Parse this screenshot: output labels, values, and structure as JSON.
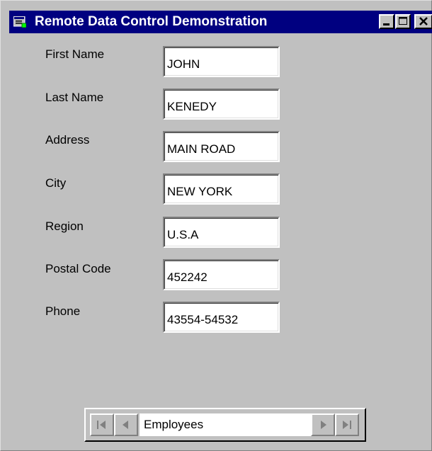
{
  "window": {
    "title": "Remote Data Control Demonstration",
    "icon": "app-form-icon"
  },
  "titlebar_buttons": {
    "minimize": "minimize-icon",
    "maximize": "maximize-icon",
    "close": "close-icon"
  },
  "fields": [
    {
      "label": "First Name",
      "value": "JOHN"
    },
    {
      "label": "Last Name",
      "value": "KENEDY"
    },
    {
      "label": "Address",
      "value": "MAIN ROAD"
    },
    {
      "label": "City",
      "value": "NEW YORK"
    },
    {
      "label": "Region",
      "value": "U.S.A"
    },
    {
      "label": "Postal Code",
      "value": "452242"
    },
    {
      "label": "Phone",
      "value": "43554-54532"
    }
  ],
  "data_control": {
    "caption": "Employees",
    "buttons": [
      "first-record-icon",
      "previous-record-icon",
      "next-record-icon",
      "last-record-icon"
    ]
  },
  "colors": {
    "titlebar": "#000080",
    "face": "#c0c0c0",
    "input_bg": "#ffffff"
  }
}
